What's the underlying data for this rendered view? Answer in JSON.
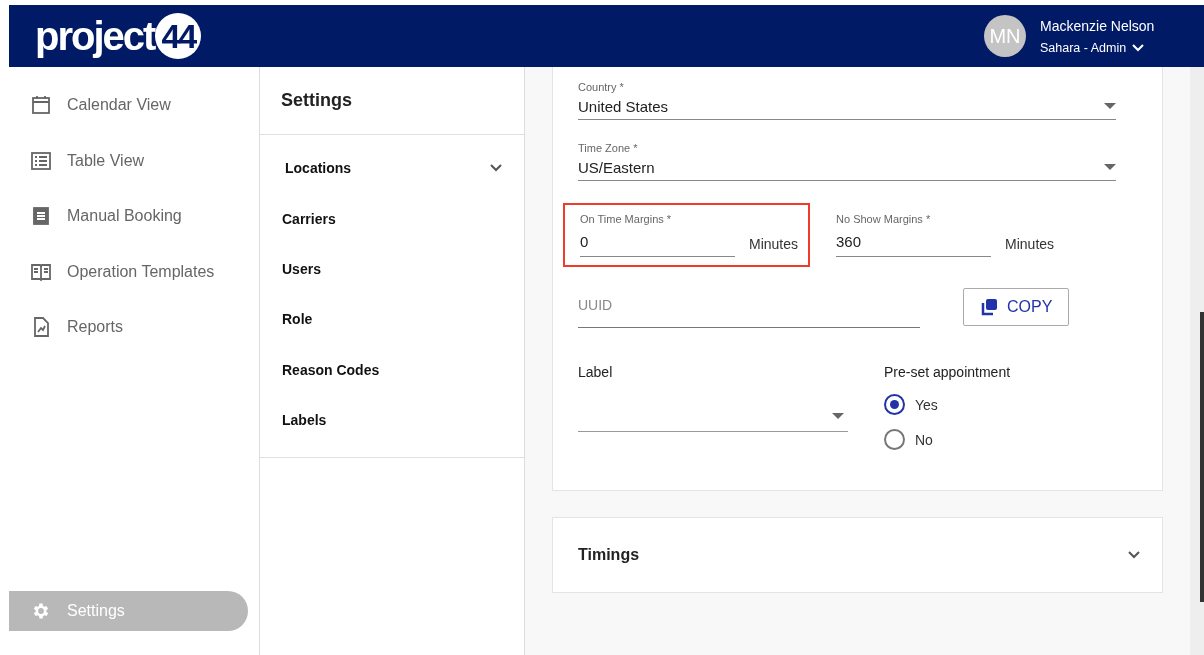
{
  "header": {
    "logo": {
      "text": "project",
      "badge": "44"
    },
    "user": {
      "initials": "MN",
      "name": "Mackenzie Nelson",
      "role": "Sahara - Admin"
    }
  },
  "sidebar": {
    "items": [
      {
        "label": "Calendar View",
        "kind": "calendar",
        "selected": false
      },
      {
        "label": "Table View",
        "kind": "list",
        "selected": false
      },
      {
        "label": "Manual Booking",
        "kind": "receipt",
        "selected": false
      },
      {
        "label": "Operation Templates",
        "kind": "book",
        "selected": false
      },
      {
        "label": "Reports",
        "kind": "report",
        "selected": false
      }
    ],
    "bottom_item": {
      "label": "Settings",
      "kind": "gear",
      "selected": true
    }
  },
  "settings_panel": {
    "title": "Settings",
    "items": [
      {
        "label": "Locations",
        "kind": "group",
        "expanded": false
      },
      {
        "label": "Carriers",
        "kind": "link"
      },
      {
        "label": "Users",
        "kind": "link"
      },
      {
        "label": "Role",
        "kind": "link"
      },
      {
        "label": "Reason Codes",
        "kind": "link"
      },
      {
        "label": "Labels",
        "kind": "link"
      }
    ]
  },
  "form": {
    "country": {
      "label": "Country *",
      "value": "United States"
    },
    "time_zone": {
      "label": "Time Zone *",
      "value": "US/Eastern"
    },
    "margins": [
      {
        "label": "On Time Margins *",
        "value": "0",
        "unit": "Minutes",
        "highlighted": true
      },
      {
        "label": "No Show Margins *",
        "value": "360",
        "unit": "Minutes",
        "highlighted": false
      }
    ],
    "uuid": {
      "placeholder": "UUID"
    },
    "copy_button": "COPY",
    "label_select": {
      "label": "Label"
    },
    "preset": {
      "label": "Pre-set appointment",
      "options": [
        {
          "label": "Yes",
          "selected": true
        },
        {
          "label": "No",
          "selected": false
        }
      ]
    }
  },
  "sections": [
    {
      "title": "Timings",
      "expanded": false
    }
  ]
}
